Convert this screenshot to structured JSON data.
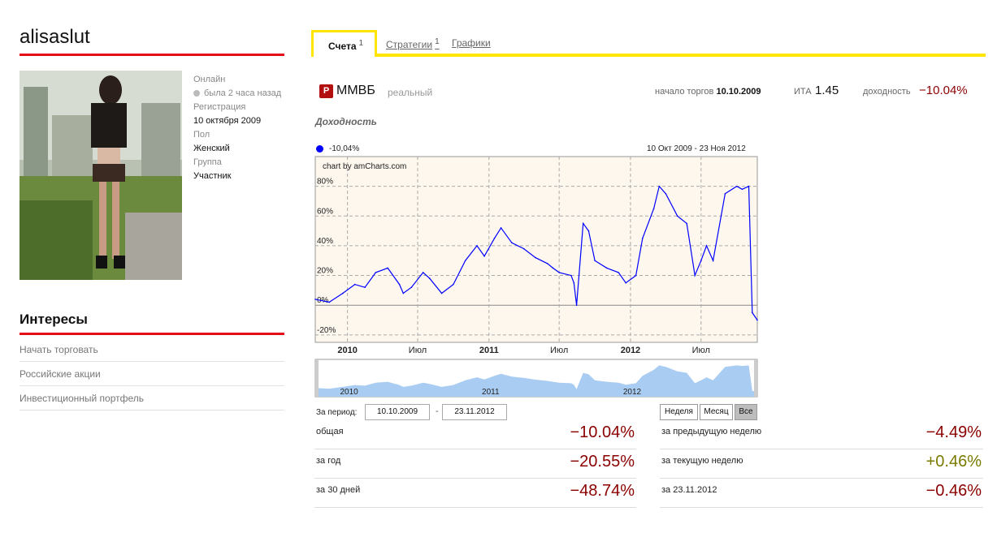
{
  "profile": {
    "username": "alisaslut",
    "meta": [
      {
        "label": "Онлайн",
        "value": "была 2 часа назад",
        "dot": true
      },
      {
        "label": "Регистрация",
        "value": "10 октября 2009"
      },
      {
        "label": "Пол",
        "value": "Женский"
      },
      {
        "label": "Группа",
        "value": "Участник"
      }
    ]
  },
  "interests": {
    "title": "Интересы",
    "items": [
      "Начать торговать",
      "Российские акции",
      "Инвестиционный портфель"
    ]
  },
  "tabs": [
    {
      "label": "Счета",
      "count": "1",
      "active": true
    },
    {
      "label": "Стратегии",
      "count": "1",
      "active": false
    },
    {
      "label": "Графики",
      "count": "",
      "active": false
    }
  ],
  "account": {
    "icon_letter": "Р",
    "name": "ММВБ",
    "type": "реальный",
    "start_label": "начало торгов",
    "start_date": "10.10.2009",
    "ita_label": "ИТА",
    "ita_value": "1.45",
    "yield_label": "доходность",
    "yield_value": "−10.04%"
  },
  "section_title": "Доходность",
  "chart_data": {
    "type": "line",
    "legend": "-10,04%",
    "range": "10 Окт 2009 - 23 Ноя 2012",
    "credit": "chart by amCharts.com",
    "ylim": [
      -25,
      100
    ],
    "y_ticks": [
      "80%",
      "60%",
      "40%",
      "20%",
      "0%",
      "-20%"
    ],
    "x_ticks": [
      {
        "label": "2010",
        "bold": true
      },
      {
        "label": "Июл",
        "bold": false
      },
      {
        "label": "2011",
        "bold": true
      },
      {
        "label": "Июл",
        "bold": false
      },
      {
        "label": "2012",
        "bold": true
      },
      {
        "label": "Июл",
        "bold": false
      }
    ],
    "scroller_labels": [
      "2010",
      "2011",
      "2012"
    ],
    "series": [
      {
        "name": "-10,04%",
        "color": "#0000ff",
        "x": [
          "2009-10-10",
          "2009-11-15",
          "2009-12-20",
          "2010-01-20",
          "2010-02-15",
          "2010-03-15",
          "2010-04-15",
          "2010-05-15",
          "2010-05-25",
          "2010-06-15",
          "2010-07-15",
          "2010-08-01",
          "2010-09-01",
          "2010-10-01",
          "2010-11-01",
          "2010-12-01",
          "2010-12-20",
          "2011-01-15",
          "2011-02-01",
          "2011-03-01",
          "2011-04-01",
          "2011-05-01",
          "2011-06-01",
          "2011-06-15",
          "2011-07-01",
          "2011-08-01",
          "2011-08-08",
          "2011-08-15",
          "2011-09-01",
          "2011-09-15",
          "2011-10-01",
          "2011-11-01",
          "2011-12-01",
          "2011-12-20",
          "2012-01-15",
          "2012-02-01",
          "2012-03-01",
          "2012-03-15",
          "2012-04-01",
          "2012-05-01",
          "2012-05-25",
          "2012-06-15",
          "2012-07-01",
          "2012-07-15",
          "2012-08-01",
          "2012-09-01",
          "2012-10-01",
          "2012-10-15",
          "2012-11-01",
          "2012-11-10",
          "2012-11-23"
        ],
        "values": [
          4,
          2,
          8,
          14,
          12,
          22,
          25,
          14,
          8,
          12,
          22,
          18,
          8,
          14,
          30,
          40,
          33,
          45,
          52,
          42,
          38,
          32,
          28,
          25,
          22,
          20,
          15,
          0,
          55,
          50,
          30,
          25,
          22,
          15,
          20,
          45,
          65,
          80,
          75,
          60,
          55,
          20,
          30,
          40,
          30,
          75,
          80,
          78,
          80,
          -5,
          -10
        ]
      }
    ]
  },
  "period": {
    "label": "За период:",
    "from": "10.10.2009",
    "to": "23.11.2012",
    "buttons": [
      {
        "label": "Неделя",
        "active": false
      },
      {
        "label": "Месяц",
        "active": false
      },
      {
        "label": "Все",
        "active": true
      }
    ]
  },
  "stats_left": [
    {
      "label": "общая",
      "value": "−10.04%",
      "sign": "neg"
    },
    {
      "label": "за год",
      "value": "−20.55%",
      "sign": "neg"
    },
    {
      "label": "за 30 дней",
      "value": "−48.74%",
      "sign": "neg"
    }
  ],
  "stats_right": [
    {
      "label": "за предыдущую неделю",
      "value": "−4.49%",
      "sign": "neg"
    },
    {
      "label": "за текущую неделю",
      "value": "+0.46%",
      "sign": "pos"
    },
    {
      "label": "за 23.11.2012",
      "value": "−0.46%",
      "sign": "neg"
    }
  ],
  "colors": {
    "accent_red": "#e30b17",
    "tab_yellow": "#ffe600",
    "negative": "#8b0000",
    "positive": "#7a7a00",
    "line": "#0000ff",
    "scroller_fill": "#a9ccf2"
  }
}
